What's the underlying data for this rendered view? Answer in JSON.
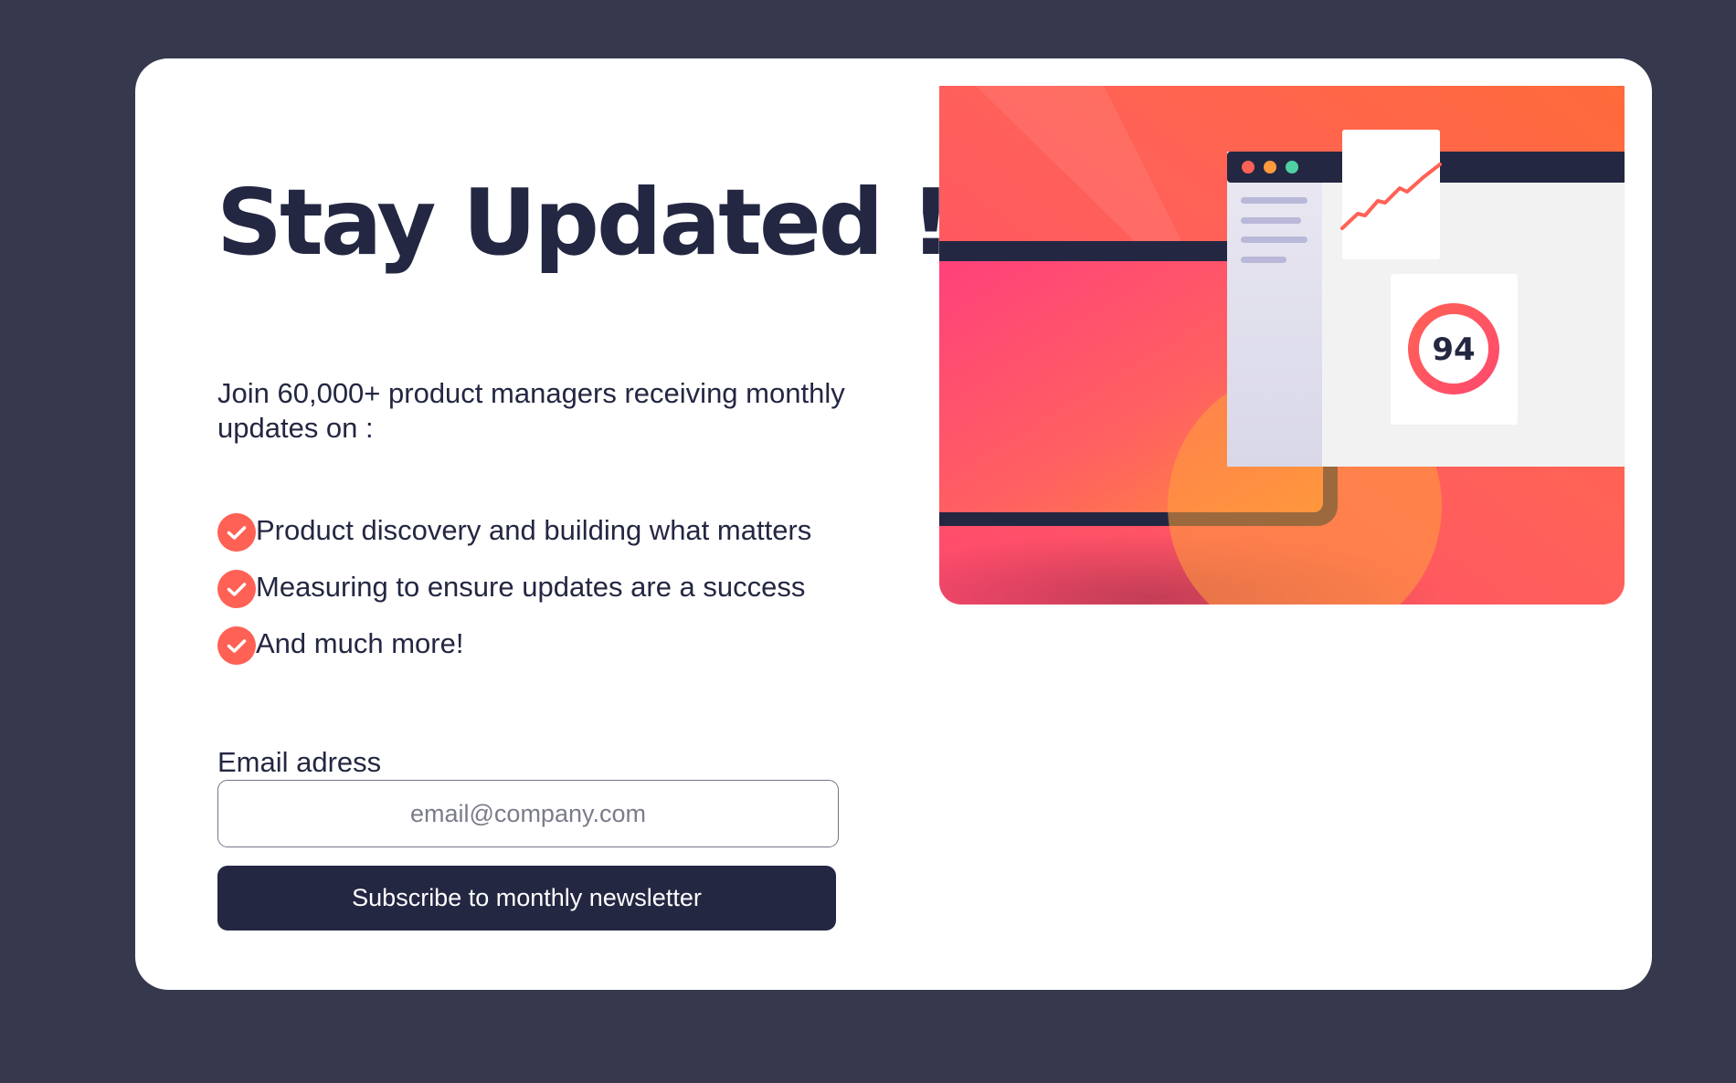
{
  "signup": {
    "title": "Stay Updated !",
    "intro": "Join 60,000+ product managers receiving monthly updates on :",
    "features": [
      "Product discovery and building what matters",
      "Measuring to ensure updates are a success",
      "And much more!"
    ],
    "email_label": "Email adress",
    "email_placeholder": "email@company.com",
    "email_value": "",
    "subscribe_label": "Subscribe to monthly newsletter"
  },
  "illustration": {
    "score": "94"
  },
  "colors": {
    "background": "#36384e",
    "card": "#ffffff",
    "dark_navy": "#242742",
    "tomato": "#ff6155",
    "pink": "#ff3f7c",
    "orange": "#ff6a3a"
  },
  "icons": {
    "check": "check-circle-icon"
  }
}
